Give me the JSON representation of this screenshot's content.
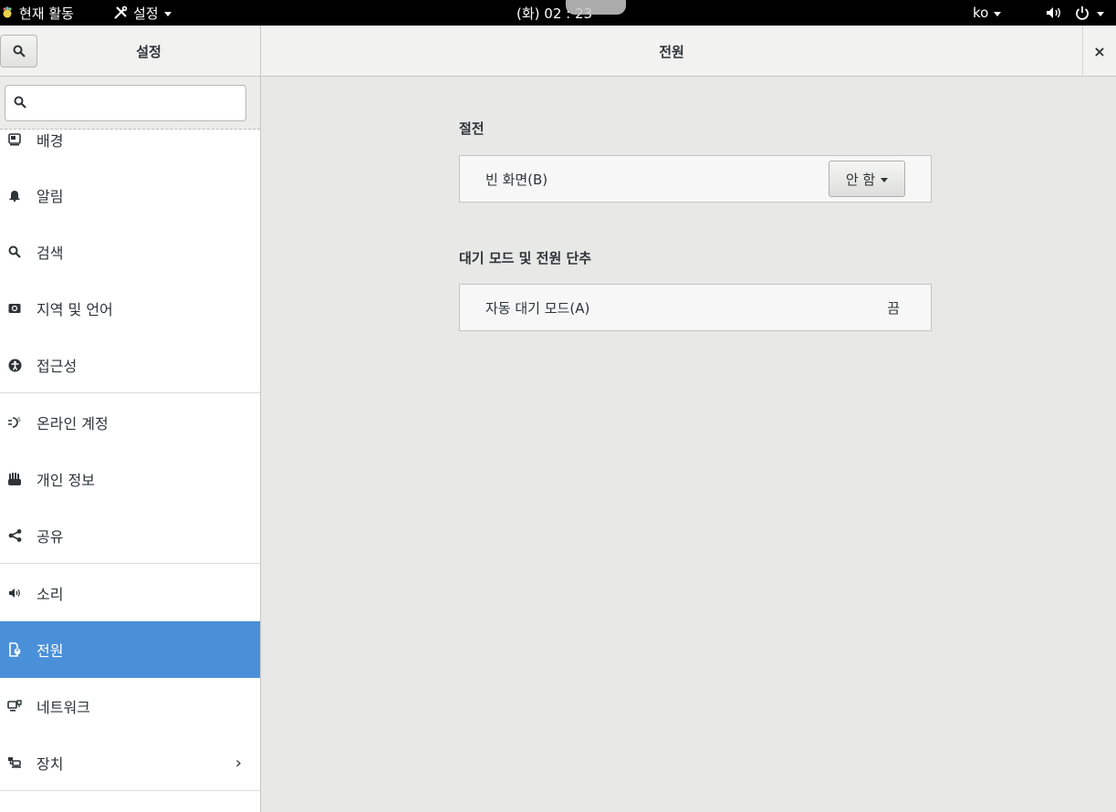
{
  "topbar": {
    "activities": "현재 활동",
    "app_menu": "설정",
    "clock": "(화) 02 : 23",
    "language": "ko"
  },
  "header": {
    "left_title": "설정",
    "title": "전원",
    "close": "×"
  },
  "search": {
    "placeholder": "",
    "value": ""
  },
  "sidebar": {
    "items": [
      {
        "label": "배경",
        "icon": "background-icon"
      },
      {
        "label": "알림",
        "icon": "bell-icon"
      },
      {
        "label": "검색",
        "icon": "search-icon"
      },
      {
        "label": "지역 및 언어",
        "icon": "region-icon"
      },
      {
        "label": "접근성",
        "icon": "accessibility-icon"
      },
      {
        "label": "온라인 계정",
        "icon": "online-accounts-icon"
      },
      {
        "label": "개인 정보",
        "icon": "hand-icon"
      },
      {
        "label": "공유",
        "icon": "share-icon"
      },
      {
        "label": "소리",
        "icon": "speaker-icon"
      },
      {
        "label": "전원",
        "icon": "power-settings-icon",
        "active": true
      },
      {
        "label": "네트워크",
        "icon": "network-icon"
      },
      {
        "label": "장치",
        "icon": "devices-icon"
      }
    ],
    "active_color": "#4a90d9"
  },
  "main": {
    "power_saving": {
      "title": "절전",
      "blank_screen": {
        "label": "빈 화면(B)",
        "value": "안 함"
      }
    },
    "suspend": {
      "title": "대기 모드 및 전원 단추",
      "auto_suspend": {
        "label": "자동 대기 모드(A)",
        "value": "끔"
      }
    }
  }
}
